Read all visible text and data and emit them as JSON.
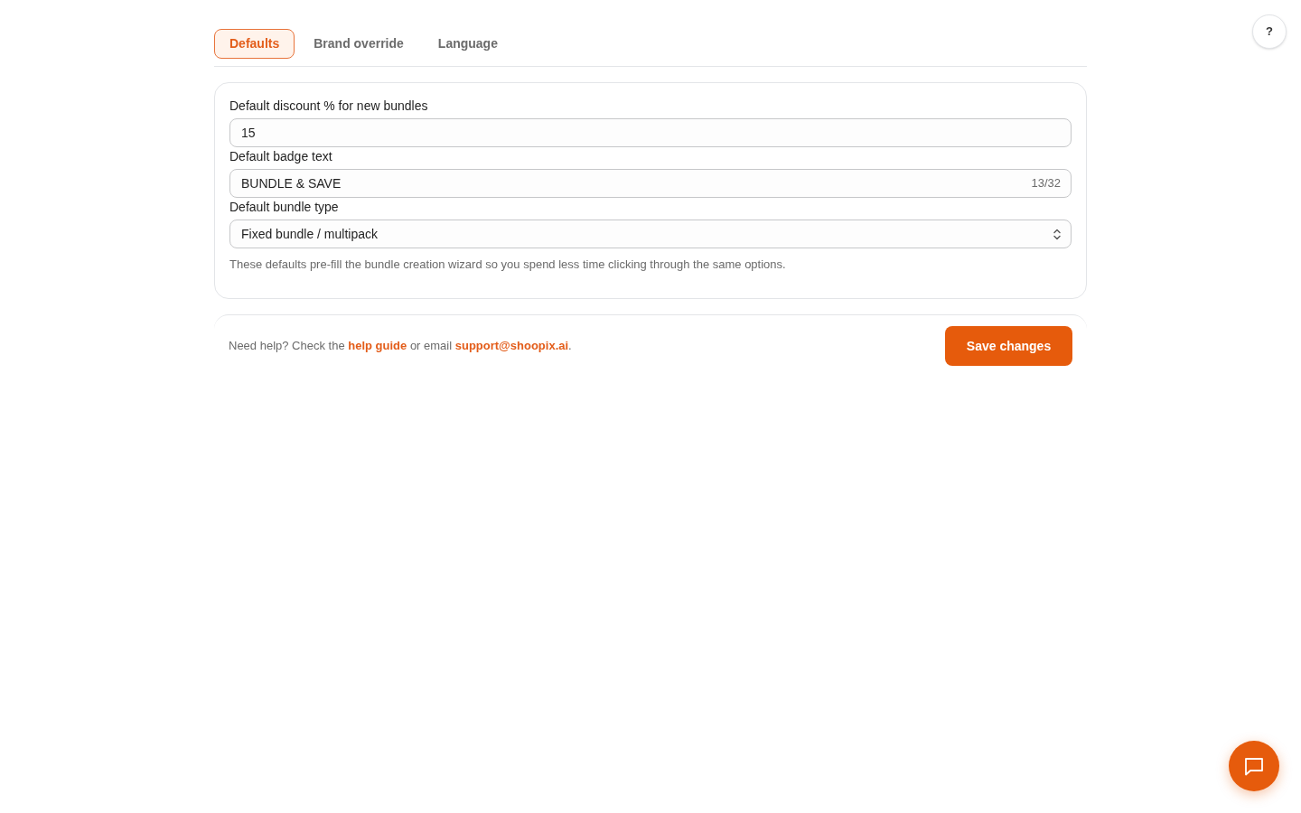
{
  "tabs": [
    {
      "label": "Defaults",
      "selected": true
    },
    {
      "label": "Brand override",
      "selected": false
    },
    {
      "label": "Language",
      "selected": false
    }
  ],
  "fields": [
    {
      "kind": "text",
      "label": "Default discount % for new bundles",
      "value": "15"
    },
    {
      "kind": "text",
      "label": "Default badge text",
      "value": "BUNDLE & SAVE",
      "counter": "13/32"
    },
    {
      "kind": "select",
      "label": "Default bundle type",
      "value": "Fixed bundle / multipack"
    }
  ],
  "hint": "These defaults pre-fill the bundle creation wizard so you spend less time clicking through the same options.",
  "footer": {
    "help_text": [
      {
        "kind": "text",
        "text": "Need help? Check the "
      },
      {
        "kind": "link",
        "text": "help guide"
      },
      {
        "kind": "text",
        "text": " or email "
      },
      {
        "kind": "email",
        "text": "support@shoopix.ai"
      },
      {
        "kind": "text",
        "text": "."
      }
    ],
    "save_button": "Save changes"
  },
  "help_button": {
    "label": "?"
  }
}
